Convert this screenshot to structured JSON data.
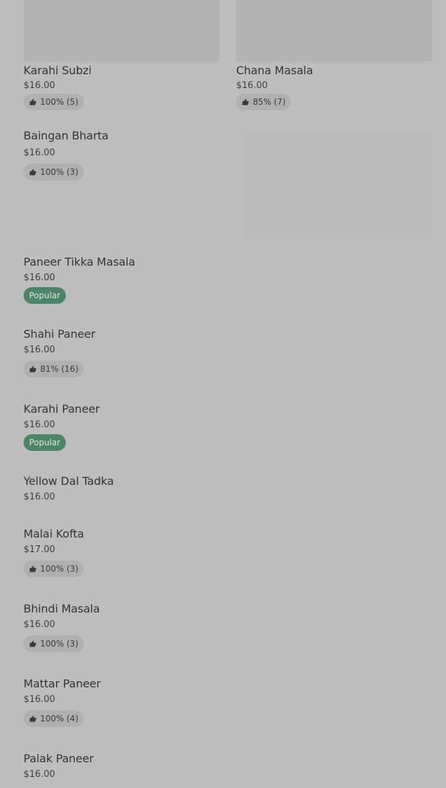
{
  "icons": {
    "rating": "thumbs-up-icon"
  },
  "colors": {
    "overlay_background": "#bdbdbd",
    "popular_badge": "#4d8465"
  },
  "menu": {
    "items": [
      {
        "name": "Karahi Subzi",
        "price": "$16.00",
        "rating": "100% (5)"
      },
      {
        "name": "Chana Masala",
        "price": "$16.00",
        "rating": "85% (7)"
      },
      {
        "name": "Baingan Bharta",
        "price": "$16.00",
        "rating": "100% (3)"
      },
      {
        "name": "Paneer Tikka Masala",
        "price": "$16.00",
        "badge": "Popular"
      },
      {
        "name": "Shahi Paneer",
        "price": "$16.00",
        "rating": "81% (16)"
      },
      {
        "name": "Karahi Paneer",
        "price": "$16.00",
        "badge": "Popular"
      },
      {
        "name": "Yellow Dal Tadka",
        "price": "$16.00"
      },
      {
        "name": "Malai Kofta",
        "price": "$17.00",
        "rating": "100% (3)"
      },
      {
        "name": "Bhindi Masala",
        "price": "$16.00",
        "rating": "100% (3)"
      },
      {
        "name": "Mattar Paneer",
        "price": "$16.00",
        "rating": "100% (4)"
      },
      {
        "name": "Palak Paneer",
        "price": "$16.00"
      }
    ]
  }
}
